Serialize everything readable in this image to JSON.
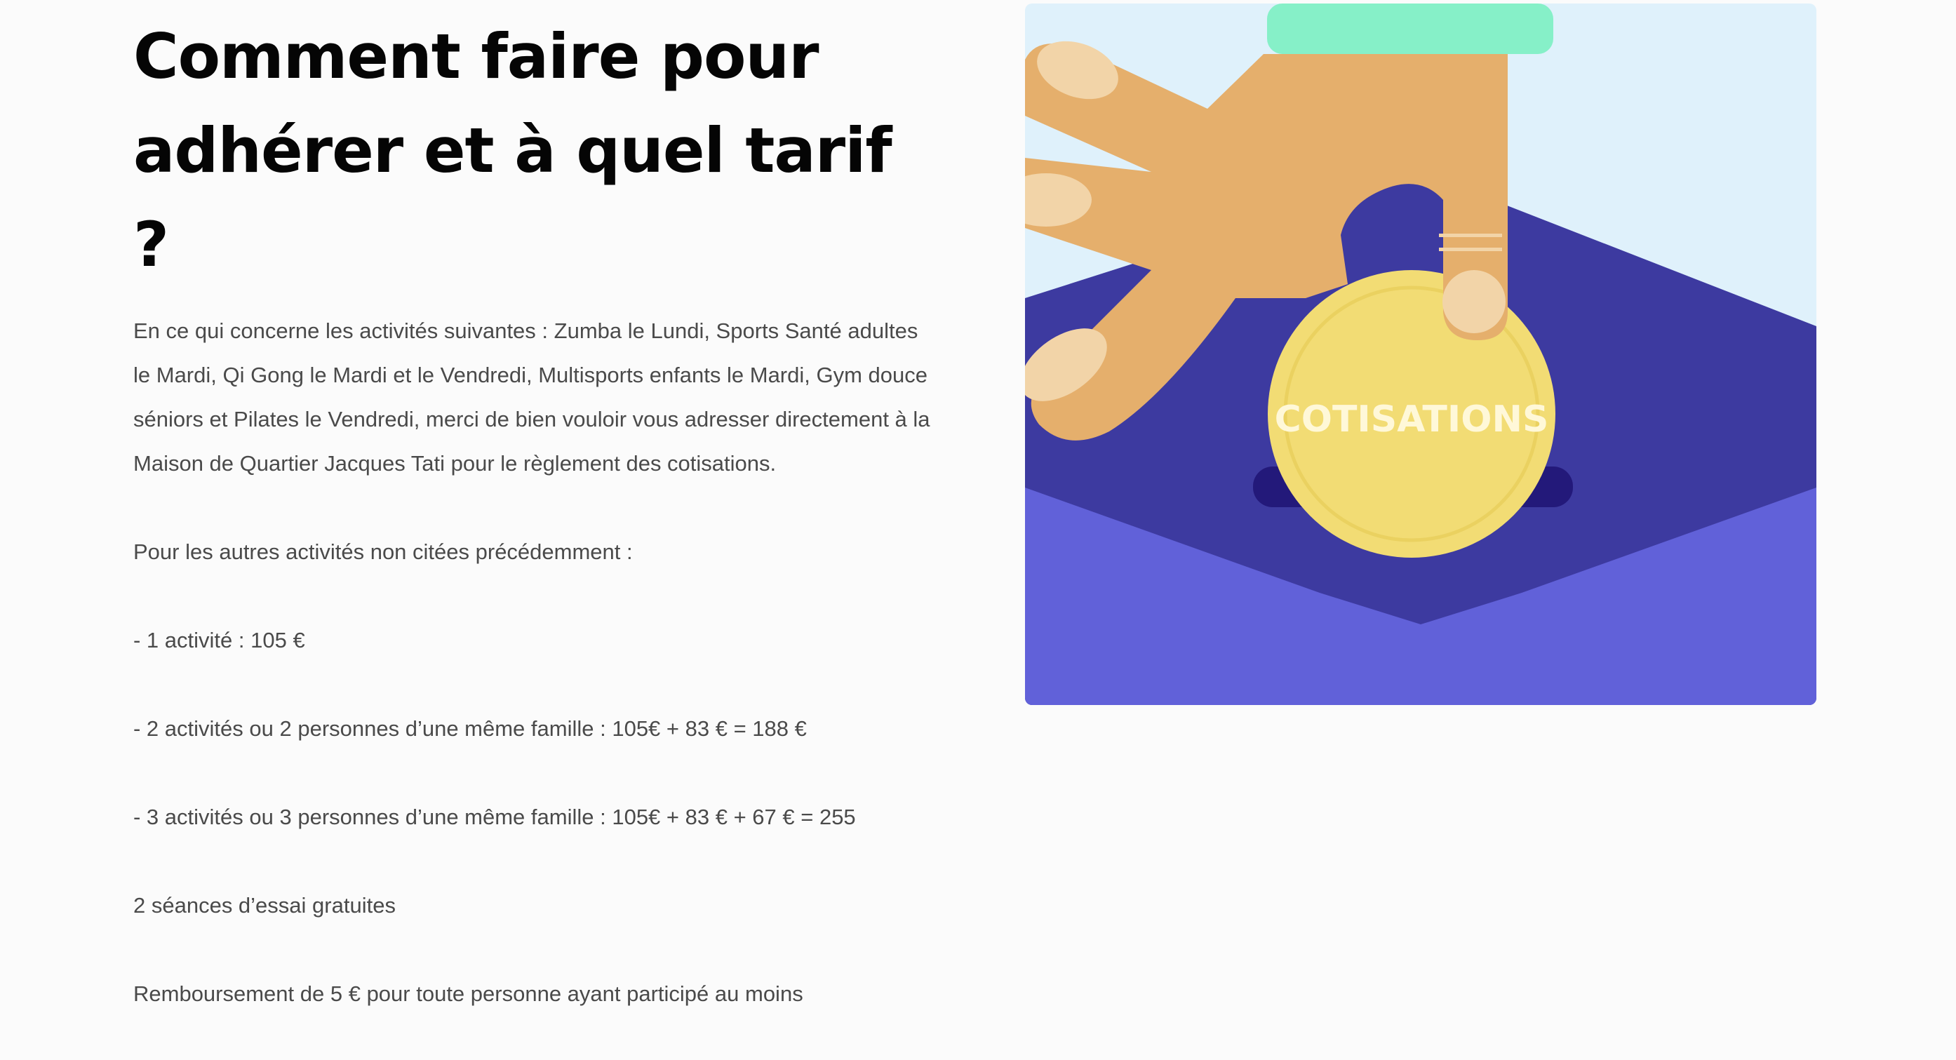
{
  "heading": "Comment faire pour adhérer et à quel tarif ?",
  "paragraphs": [
    "En ce qui concerne les activités suivantes : Zumba le Lundi, Sports Santé adultes le Mardi, Qi Gong le Mardi et le Vendredi, Multisports enfants le Mardi, Gym douce séniors et Pilates le Vendredi, merci de bien vouloir vous adresser directement à la Maison de Quartier Jacques Tati pour le règlement des cotisations.",
    "Pour les autres activités non citées précédemment :",
    "- 1 activité : 105 €",
    "- 2 activités ou 2 personnes d’une même famille : 105€ + 83 € = 188 €",
    "- 3 activités ou 3 personnes d’une même famille : 105€ + 83 € + 67 € = 255",
    "2 séances d’essai gratuites",
    "Remboursement de 5 € pour toute personne ayant participé au moins"
  ],
  "illustration": {
    "coin_label": "COTISATIONS",
    "colors": {
      "sky": "#dff1fb",
      "envelope_dark": "#3d3aa0",
      "envelope_light": "#6161d9",
      "hand": "#e5af6c",
      "nail": "#f2d4a8",
      "coin": "#f2dc74",
      "slot": "#23197a",
      "sleeve": "#86f0c8"
    }
  }
}
